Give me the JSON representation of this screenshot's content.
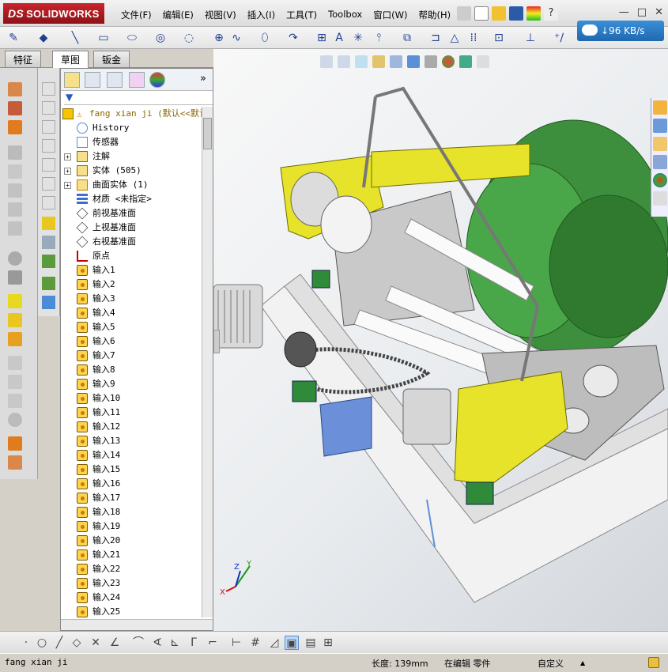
{
  "app": {
    "logo_prefix": "DS",
    "logo_text": "SOLIDWORKS"
  },
  "menu": [
    "文件(F)",
    "编辑(E)",
    "视图(V)",
    "插入(I)",
    "工具(T)",
    "Toolbox",
    "窗口(W)",
    "帮助(H)"
  ],
  "window_controls": {
    "minimize": "—",
    "restore": "□",
    "close": "✕"
  },
  "network_badge": {
    "text": "↓96 KB/s"
  },
  "tabs": [
    "特征",
    "草图",
    "钣金"
  ],
  "active_tab": "草图",
  "feature_tree": {
    "root": "fang xian ji  (默认<<默认",
    "items": [
      {
        "label": "History",
        "icon": "history-icon",
        "expand": ""
      },
      {
        "label": "传感器",
        "icon": "sensor-icon",
        "expand": ""
      },
      {
        "label": "注解",
        "icon": "annotation-icon",
        "expand": "+"
      },
      {
        "label": "实体 (505)",
        "icon": "solid-bodies-icon",
        "expand": "+"
      },
      {
        "label": "曲面实体 (1)",
        "icon": "surface-bodies-icon",
        "expand": "+"
      },
      {
        "label": "材质 <未指定>",
        "icon": "material-icon",
        "expand": ""
      },
      {
        "label": "前视基准面",
        "icon": "plane-icon",
        "expand": ""
      },
      {
        "label": "上视基准面",
        "icon": "plane-icon",
        "expand": ""
      },
      {
        "label": "右视基准面",
        "icon": "plane-icon",
        "expand": ""
      },
      {
        "label": "原点",
        "icon": "origin-icon",
        "expand": ""
      },
      {
        "label": "输入1",
        "icon": "import-icon",
        "expand": ""
      },
      {
        "label": "输入2",
        "icon": "import-icon",
        "expand": ""
      },
      {
        "label": "输入3",
        "icon": "import-icon",
        "expand": ""
      },
      {
        "label": "输入4",
        "icon": "import-icon",
        "expand": ""
      },
      {
        "label": "输入5",
        "icon": "import-icon",
        "expand": ""
      },
      {
        "label": "输入6",
        "icon": "import-icon",
        "expand": ""
      },
      {
        "label": "输入7",
        "icon": "import-icon",
        "expand": ""
      },
      {
        "label": "输入8",
        "icon": "import-icon",
        "expand": ""
      },
      {
        "label": "输入9",
        "icon": "import-icon",
        "expand": ""
      },
      {
        "label": "输入10",
        "icon": "import-icon",
        "expand": ""
      },
      {
        "label": "输入11",
        "icon": "import-icon",
        "expand": ""
      },
      {
        "label": "输入12",
        "icon": "import-icon",
        "expand": ""
      },
      {
        "label": "输入13",
        "icon": "import-icon",
        "expand": ""
      },
      {
        "label": "输入14",
        "icon": "import-icon",
        "expand": ""
      },
      {
        "label": "输入15",
        "icon": "import-icon",
        "expand": ""
      },
      {
        "label": "输入16",
        "icon": "import-icon",
        "expand": ""
      },
      {
        "label": "输入17",
        "icon": "import-icon",
        "expand": ""
      },
      {
        "label": "输入18",
        "icon": "import-icon",
        "expand": ""
      },
      {
        "label": "输入19",
        "icon": "import-icon",
        "expand": ""
      },
      {
        "label": "输入20",
        "icon": "import-icon",
        "expand": ""
      },
      {
        "label": "输入21",
        "icon": "import-icon",
        "expand": ""
      },
      {
        "label": "输入22",
        "icon": "import-icon",
        "expand": ""
      },
      {
        "label": "输入23",
        "icon": "import-icon",
        "expand": ""
      },
      {
        "label": "输入24",
        "icon": "import-icon",
        "expand": ""
      },
      {
        "label": "输入25",
        "icon": "import-icon",
        "expand": ""
      }
    ]
  },
  "triad": {
    "x": "X",
    "y": "Y",
    "z": "Z"
  },
  "status": {
    "filename": "fang xian ji",
    "length": "长度: 139mm",
    "mode": "在编辑 零件",
    "units": "自定义",
    "units_arrow": "▲"
  },
  "colors": {
    "accent_red": "#b5161c",
    "frame_gray": "#d4d0c8",
    "model_green": "#3f9a3f",
    "model_yellow": "#e6e21e"
  }
}
